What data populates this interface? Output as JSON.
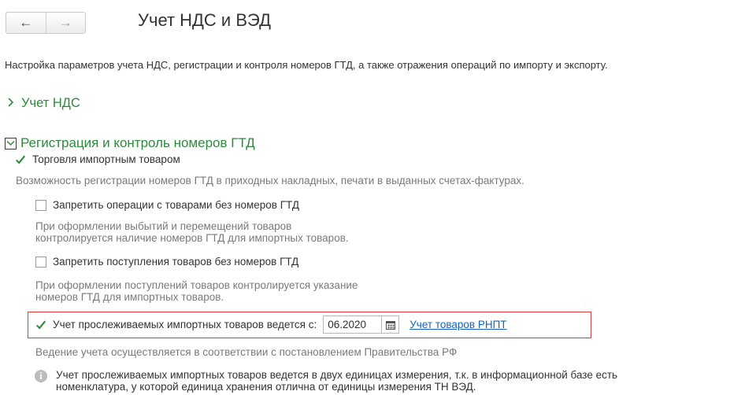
{
  "header": {
    "back_glyph": "←",
    "forward_glyph": "→",
    "title": "Учет НДС и ВЭД"
  },
  "description": "Настройка параметров учета НДС, регистрации и контроля номеров ГТД, а также отражения операций по импорту и экспорту.",
  "sections": {
    "vat": {
      "label": "Учет НДС",
      "expanded": false
    },
    "gtd": {
      "label": "Регистрация и контроль номеров ГТД",
      "expanded": true,
      "import_trade": {
        "label": "Торговля импортным товаром",
        "checked": true,
        "hint": "Возможность регистрации номеров ГТД в приходных накладных, печати в выданных счетах-фактурах."
      },
      "forbid_ops": {
        "label": "Запретить операции с товарами без номеров ГТД",
        "checked": false,
        "hint_line1": "При оформлении выбытий и перемещений товаров",
        "hint_line2": "контролируется наличие номеров ГТД для импортных товаров."
      },
      "forbid_receipts": {
        "label": "Запретить поступления товаров без номеров ГТД",
        "checked": false,
        "hint_line1": "При оформлении поступлений товаров контролируется указание",
        "hint_line2": "номеров ГТД для импортных товаров."
      },
      "traceable": {
        "label": "Учет прослеживаемых импортных товаров ведется с:",
        "checked": true,
        "date_value": "06.2020",
        "link_label": "Учет товаров РНПТ",
        "hint": "Ведение учета осуществляется в соответствии с постановлением Правительства РФ"
      },
      "info": {
        "icon_glyph": "i",
        "line1": "Учет прослеживаемых импортных товаров ведется в двух единицах измерения, т.к. в информационной базе есть",
        "line2": "номенклатура, у которой единица хранения отлична от единицы измерения ТН ВЭД."
      }
    }
  },
  "colors": {
    "section_green": "#2d8a3d",
    "highlight_red": "#e53935",
    "link_blue": "#1565c0",
    "hint_gray": "#7a7a7a"
  }
}
